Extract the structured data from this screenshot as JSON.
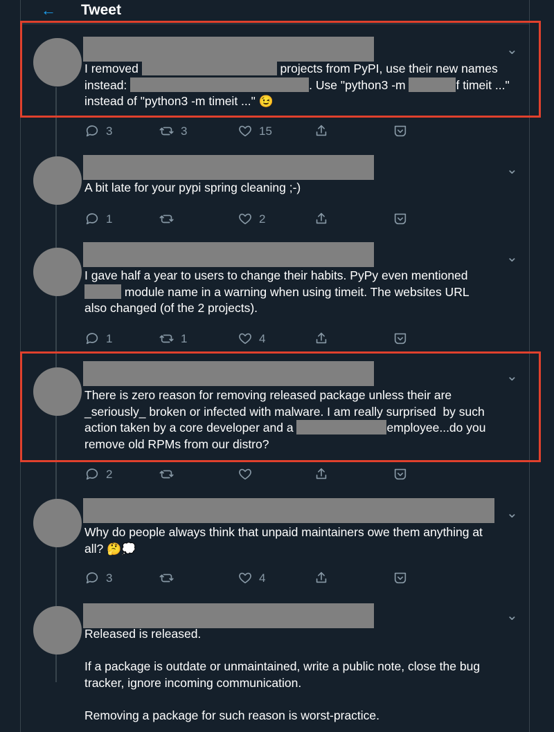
{
  "header": {
    "title": "Tweet",
    "back_icon": "arrow-left-icon",
    "accent": "#1da1f2"
  },
  "tweets": [
    {
      "lines": [
        [
          {
            "t": "I removed "
          },
          {
            "r": 195
          },
          {
            "t": " projects from PyPI, use their new names"
          }
        ],
        [
          {
            "t": "instead: "
          },
          {
            "r": 258
          },
          {
            "t": ". Use \"python3 -m "
          },
          {
            "r": 68
          },
          {
            "t": "f timeit ...\""
          }
        ],
        [
          {
            "t": "instead of \"python3 -m timeit ...\" "
          },
          {
            "e": "😉"
          }
        ]
      ],
      "replies": "3",
      "retweets": "3",
      "likes": "15",
      "highlighted": true
    },
    {
      "lines": [
        [
          {
            "t": "A bit late for your pypi spring cleaning ;-)"
          }
        ]
      ],
      "replies": "1",
      "retweets": "",
      "likes": "2",
      "highlighted": false
    },
    {
      "lines": [
        [
          {
            "t": "I gave half a year to users to change their habits. PyPy even mentioned"
          }
        ],
        [
          {
            "r": 53
          },
          {
            "t": " module name in a warning when using timeit. The websites URL"
          }
        ],
        [
          {
            "t": "also changed (of the 2 projects)."
          }
        ]
      ],
      "replies": "1",
      "retweets": "1",
      "likes": "4",
      "highlighted": false
    },
    {
      "lines": [
        [
          {
            "t": "There is zero reason for removing released package unless their are"
          }
        ],
        [
          {
            "t": "_seriously_ broken or infected with malware. I am really surprised  by such"
          }
        ],
        [
          {
            "t": "action taken by a core developer and a "
          },
          {
            "r": 130
          },
          {
            "t": "employee...do you"
          }
        ],
        [
          {
            "t": "remove old RPMs from our distro?"
          }
        ]
      ],
      "replies": "2",
      "retweets": "",
      "likes": "",
      "highlighted": true
    },
    {
      "lines": [
        [
          {
            "t": "Why do people always think that unpaid maintainers owe them anything at"
          }
        ],
        [
          {
            "t": "all? "
          },
          {
            "e": "🤔💭"
          }
        ]
      ],
      "replies": "3",
      "retweets": "",
      "likes": "4",
      "highlighted": false
    },
    {
      "lines": [
        [
          {
            "t": "Released is released."
          }
        ],
        [],
        [
          {
            "t": "If a package is outdate or unmaintained, write a public note, close the bug"
          }
        ],
        [
          {
            "t": "tracker, ignore incoming communication."
          }
        ],
        [],
        [
          {
            "t": "Removing a package for such reason is worst-practice."
          }
        ]
      ],
      "replies": "",
      "retweets": "",
      "likes": "",
      "highlighted": false
    }
  ],
  "icons": {
    "reply": "reply-icon",
    "retweet": "retweet-icon",
    "like": "heart-icon",
    "share": "share-icon",
    "more": "chevron-down-icon"
  },
  "colors": {
    "background": "#15202b",
    "muted": "#8899a6",
    "redaction": "#808080",
    "highlight": "#e0412d"
  }
}
